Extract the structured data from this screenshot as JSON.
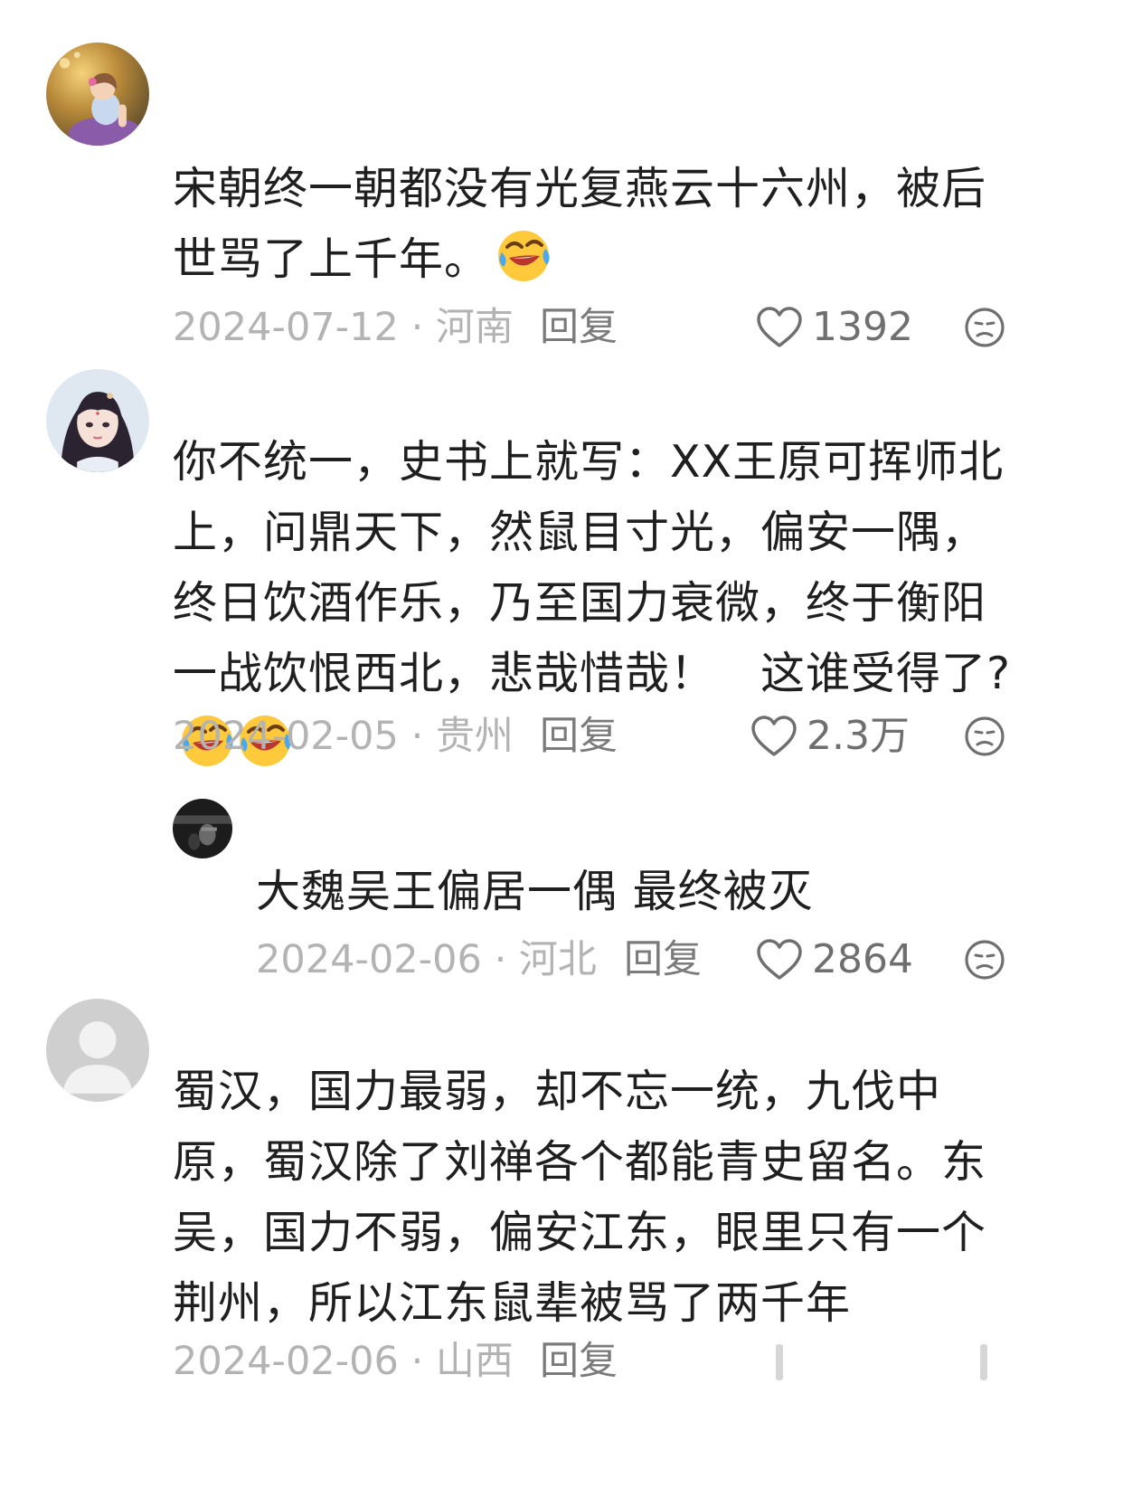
{
  "comments": [
    {
      "avatar": "girl-sitting-grass-avatar",
      "text": "宋朝终一朝都没有光复燕云十六州，被后世骂了上千年。",
      "emoji": "rolling-laughing-emoji",
      "date": "2024-07-12",
      "separator": " · ",
      "region": "河南",
      "reply_label": "回复",
      "likes": "1392"
    },
    {
      "avatar": "anime-princess-avatar",
      "text": "你不统一，史书上就写：XX王原可挥师北上，问鼎天下，然鼠目寸光，偏安一隅，终日饮酒作乐，乃至国力衰微，终于衡阳一战饮恨西北，悲哉惜哉！　这谁受得了?",
      "emoji": "rolling-laughing-emoji",
      "date": "2024-02-05",
      "separator": " · ",
      "region": "贵州",
      "reply_label": "回复",
      "likes": "2.3万"
    },
    {
      "avatar": "dark-photo-avatar",
      "text": "大魏吴王偏居一偶 最终被灭",
      "date": "2024-02-06",
      "separator": " · ",
      "region": "河北",
      "reply_label": "回复",
      "likes": "2864"
    },
    {
      "avatar": "default-user-avatar",
      "text": "蜀汉，国力最弱，却不忘一统，九伐中原，蜀汉除了刘禅各个都能青史留名。东吴，国力不弱，偏安江东，眼里只有一个荆州，所以江东鼠辈被骂了两千年",
      "date": "2024-02-06",
      "separator": " · ",
      "region": "山西",
      "reply_label": "回复"
    }
  ],
  "colors": {
    "text": "#1f1f1f",
    "meta": "#b3b3b3",
    "reply": "#7b7b7b",
    "icon": "#6f6f6f",
    "background": "#ffffff"
  }
}
